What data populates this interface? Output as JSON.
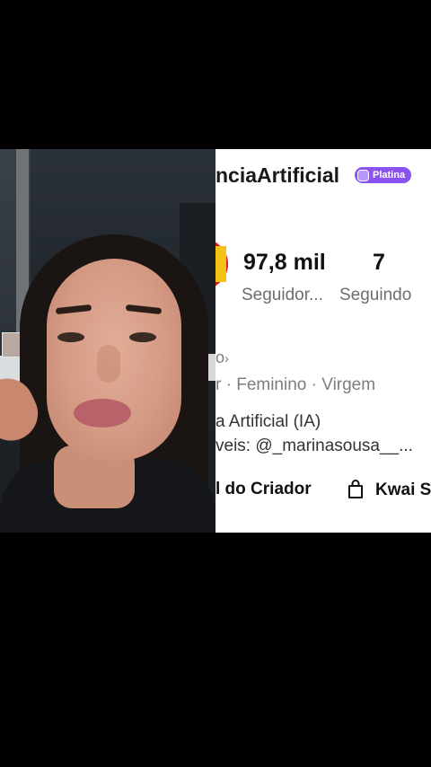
{
  "profile": {
    "username_fragment": "nciaArtificial",
    "badge_label": "Platina",
    "followers_count": "97,8 mil",
    "followers_label": "Seguidor...",
    "following_count": "7",
    "following_label": "Seguindo",
    "meta_link": "o",
    "meta_arrow": "›",
    "tags": "r · Feminino · Virgem",
    "bio_line1": "a Artificial (IA)",
    "bio_line2": "veis: @_marinasousa__...",
    "creator_link": "l do Criador",
    "shop_label": "Kwai S"
  },
  "colors": {
    "badge": "#8a53f0",
    "avatar_ring": "#d41f26",
    "secondary_text": "#6d6d6d"
  },
  "icons": {
    "badge": "platina-badge-icon",
    "shop": "shopping-bag-icon"
  }
}
